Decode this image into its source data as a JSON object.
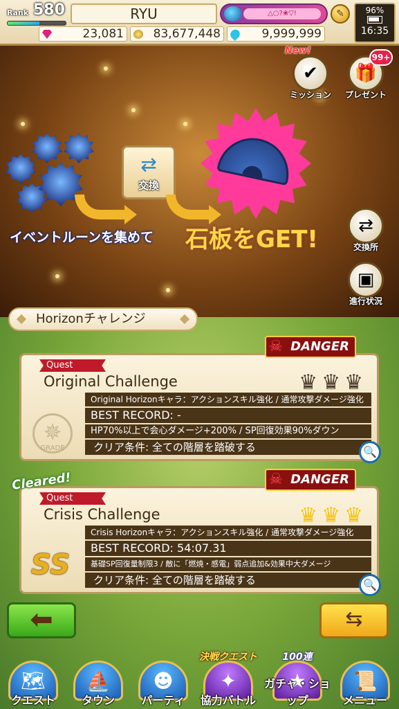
{
  "status": {
    "rank_label": "Rank",
    "rank_value": "580",
    "player_name": "RYU",
    "title_badge": "△○?❀▽!",
    "gems": "23,081",
    "coins": "83,677,448",
    "stamina_drops": "9,999,999",
    "battery": "96%",
    "clock": "16:35"
  },
  "banner": {
    "exchange_label": "交換",
    "headline_small": "イベントルーンを集めて",
    "headline_big": "石板をGET!",
    "mission_new": "New!",
    "mission_label": "ミッション",
    "present_label": "プレゼント",
    "present_count": "99+",
    "exchange_shop_label": "交換所",
    "progress_label": "進行状況"
  },
  "section": {
    "title": "Horizonチャレンジ"
  },
  "quests": [
    {
      "tag": "Quest",
      "danger": "DANGER",
      "title": "Original Challenge",
      "condition_line": "Original Horizonキャラ：アクションスキル強化 / 通常攻撃ダメージ強化",
      "best_record": "BEST RECORD: -",
      "modifier": "HP70%以上で会心ダメージ+200% / SP回復効果90%ダウン",
      "clear_condition": "クリア条件: 全ての階層を踏破する",
      "grade": "GRADE",
      "crowns_earned": 0,
      "crowns_total": 3
    },
    {
      "cleared": "Cleared!",
      "tag": "Quest",
      "danger": "DANGER",
      "title": "Crisis Challenge",
      "condition_line": "Crisis Horizonキャラ：アクションスキル強化 / 通常攻撃ダメージ強化",
      "best_record": "BEST RECORD: 54:07.31",
      "modifier": "基礎SP回復量制限3 / 敵に「燃焼・感電」弱点追加&効果中大ダメージ",
      "clear_condition": "クリア条件: 全ての階層を踏破する",
      "grade": "SS",
      "crowns_earned": 3,
      "crowns_total": 3
    }
  ],
  "nav": {
    "quest": "クエスト",
    "town": "タウン",
    "party": "パーティ",
    "coop": "協力バトル",
    "coop_event": "決戦クエスト",
    "gacha": "ガチャ・ショップ",
    "gacha_event": "100連",
    "menu": "メニュー"
  },
  "colors": {
    "crown_gold": "#f5c518",
    "crown_dark": "#4a3a2a",
    "danger_red": "#8a1010"
  }
}
